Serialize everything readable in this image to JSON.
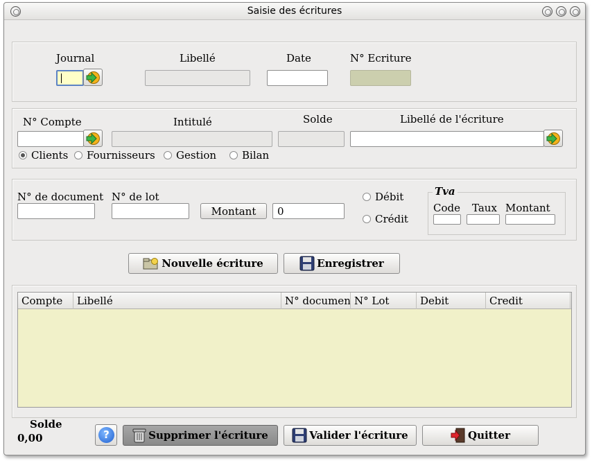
{
  "window": {
    "title": "Saisie des écritures"
  },
  "header_section": {
    "journal_label": "Journal",
    "journal_value": "",
    "libelle_label": "Libellé",
    "libelle_value": "",
    "date_label": "Date",
    "date_value": "",
    "ecriture_label": "N° Ecriture",
    "ecriture_value": ""
  },
  "account_section": {
    "compte_label": "N° Compte",
    "compte_value": "",
    "intitule_label": "Intitulé",
    "intitule_value": "",
    "solde_label": "Solde",
    "solde_value": "",
    "libelle_ecriture_label": "Libellé de l'écriture",
    "libelle_ecriture_value": "",
    "account_types": [
      "Clients",
      "Fournisseurs",
      "Gestion",
      "Bilan"
    ],
    "selected_account_type": "Clients"
  },
  "entry_section": {
    "document_label": "N° de document",
    "document_value": "",
    "lot_label": "N° de lot",
    "lot_value": "",
    "montant_button": "Montant",
    "montant_value": "0",
    "debit_label": "Débit",
    "credit_label": "Crédit",
    "tva": {
      "legend": "Tva",
      "code_label": "Code",
      "taux_label": "Taux",
      "montant_label": "Montant"
    }
  },
  "actions": {
    "new_entry": "Nouvelle écriture",
    "save": "Enregistrer"
  },
  "table": {
    "columns": [
      "Compte",
      "Libellé",
      "N° document",
      "N° Lot",
      "Debit",
      "Credit"
    ],
    "rows": []
  },
  "footer": {
    "solde_label": "Solde",
    "solde_value": "0,00",
    "delete": "Supprimer l'écriture",
    "validate": "Valider l'écriture",
    "quit": "Quitter"
  },
  "icons": {
    "go": "arrow-right-icon",
    "help": "help-icon",
    "trash": "trash-icon",
    "floppy": "floppy-icon",
    "exit": "exit-door-icon",
    "new": "new-folder-icon"
  }
}
